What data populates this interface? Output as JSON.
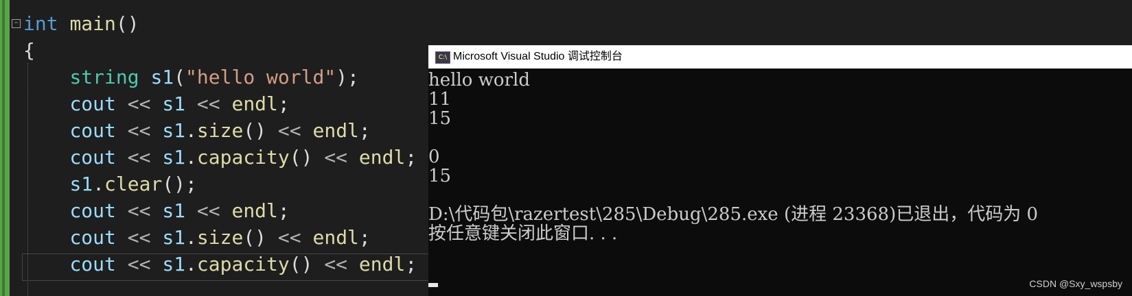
{
  "editor": {
    "lines": [
      "int main()",
      "{",
      "    string s1(\"hello world\");",
      "    cout << s1 << endl;",
      "    cout << s1.size() << endl;",
      "    cout << s1.capacity() << endl;",
      "    s1.clear();",
      "    cout << s1 << endl;",
      "    cout << s1.size() << endl;",
      "    cout << s1.capacity() << endl;"
    ]
  },
  "console": {
    "icon_text": "C:\\",
    "title": "Microsoft Visual Studio 调试控制台",
    "output": [
      "hello world",
      "11",
      "15",
      "",
      "0",
      "15",
      "",
      "D:\\代码包\\razertest\\285\\Debug\\285.exe (进程 23368)已退出，代码为 0",
      "按任意键关闭此窗口. . ."
    ]
  },
  "watermark": "CSDN @Sxy_wspsby",
  "colors": {
    "editor_bg": "#1e1e1e",
    "keyword": "#569cd6",
    "function": "#dcdcaa",
    "type": "#4ec9b0",
    "variable": "#9cdcfe",
    "string": "#d69d85",
    "console_bg": "#0c0c0c",
    "console_text": "#cccccc",
    "change_bar": "#57a64a"
  }
}
